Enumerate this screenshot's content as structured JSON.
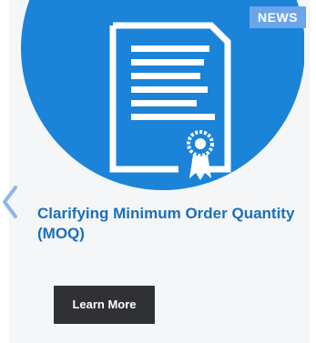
{
  "card": {
    "badge": "NEWS",
    "title": "Clarifying Minimum Order Quantity (MOQ)",
    "cta_label": "Learn More",
    "hero_icon": "certificate-document-icon",
    "nav_icon": "chevron-left-icon"
  },
  "colors": {
    "hero_blue": "#1b84d8",
    "badge_blue": "#6aa6e8",
    "title_blue": "#1b6fb8",
    "button_dark": "#2f3135",
    "card_bg": "#f5f6f7"
  }
}
